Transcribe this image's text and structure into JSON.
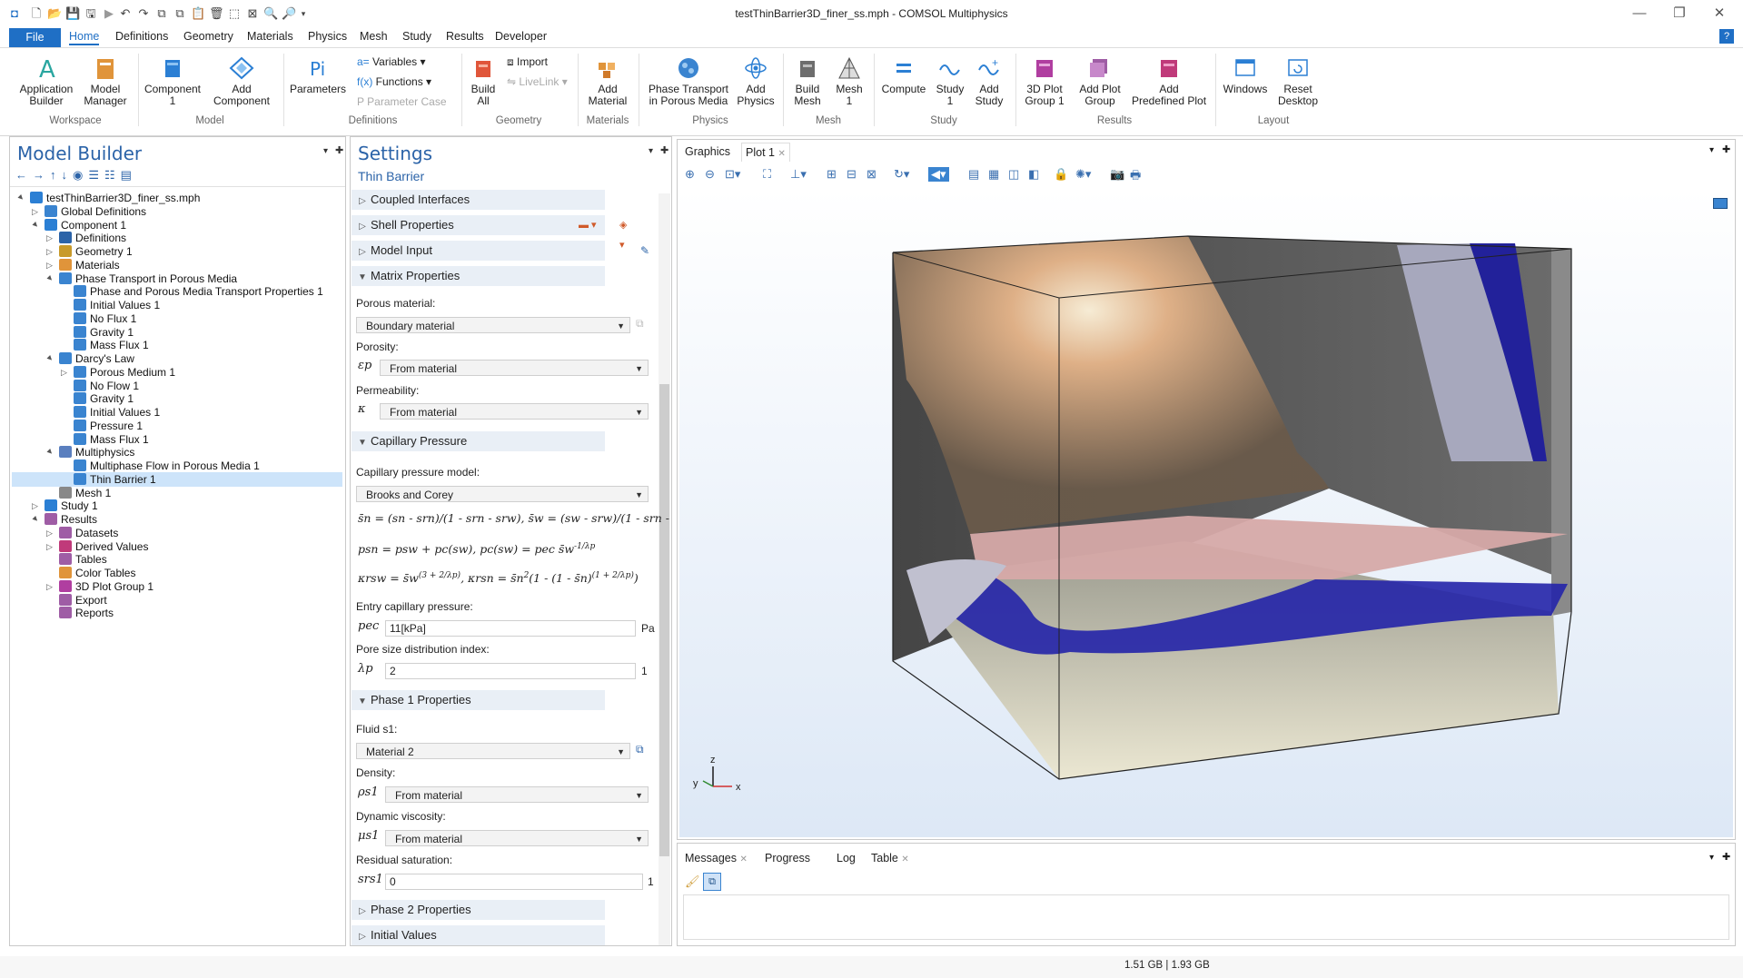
{
  "window": {
    "title": "testThinBarrier3D_finer_ss.mph - COMSOL Multiphysics"
  },
  "menu": [
    "File",
    "Home",
    "Definitions",
    "Geometry",
    "Materials",
    "Physics",
    "Mesh",
    "Study",
    "Results",
    "Developer"
  ],
  "ribbon": {
    "app_builder": "Application\nBuilder",
    "model_manager": "Model\nManager",
    "component": "Component\n1",
    "add_component": "Add\nComponent",
    "parameters": "Parameters",
    "variables": "Variables",
    "functions": "Functions",
    "parameter_case": "Parameter Case",
    "import": "Import",
    "livelink": "LiveLink",
    "build_all": "Build\nAll",
    "add_material": "Add\nMaterial",
    "phase_transport": "Phase Transport\nin Porous Media",
    "add_physics": "Add\nPhysics",
    "build_mesh": "Build\nMesh",
    "mesh1": "Mesh\n1",
    "compute": "Compute",
    "study1": "Study\n1",
    "add_study": "Add\nStudy",
    "plot3d": "3D Plot\nGroup 1",
    "add_plot_group": "Add Plot\nGroup",
    "add_predefined_plot": "Add\nPredefined Plot",
    "windows": "Windows",
    "reset_desktop": "Reset\nDesktop",
    "groups": [
      "Workspace",
      "Model",
      "Definitions",
      "Geometry",
      "Materials",
      "Physics",
      "Mesh",
      "Study",
      "Results",
      "Layout"
    ]
  },
  "model_builder": {
    "title": "Model Builder",
    "tree": [
      "testThinBarrier3D_finer_ss.mph",
      "Global Definitions",
      "Component 1",
      "Definitions",
      "Geometry 1",
      "Materials",
      "Phase Transport in Porous Media",
      "Phase and Porous Media Transport Properties 1",
      "Initial Values 1",
      "No Flux 1",
      "Gravity 1",
      "Mass Flux 1",
      "Darcy's Law",
      "Porous Medium 1",
      "No Flow 1",
      "Gravity 1",
      "Initial Values 1",
      "Pressure 1",
      "Mass Flux 1",
      "Multiphysics",
      "Multiphase Flow in Porous Media 1",
      "Thin Barrier 1",
      "Mesh 1",
      "Study 1",
      "Results",
      "Datasets",
      "Derived Values",
      "Tables",
      "Color Tables",
      "3D Plot Group 1",
      "Export",
      "Reports"
    ]
  },
  "settings": {
    "title": "Settings",
    "subtitle": "Thin Barrier",
    "sections": {
      "coupled": "Coupled Interfaces",
      "shell": "Shell Properties",
      "model_input": "Model Input",
      "matrix": "Matrix Properties",
      "capillary": "Capillary Pressure",
      "phase1": "Phase 1 Properties",
      "phase2": "Phase 2 Properties",
      "initial": "Initial Values"
    },
    "porous_material_label": "Porous material:",
    "porous_material_value": "Boundary material",
    "porosity_label": "Porosity:",
    "porosity_sym": "εp",
    "porosity_value": "From material",
    "permeability_label": "Permeability:",
    "permeability_sym": "κ",
    "permeability_value": "From material",
    "cap_model_label": "Capillary pressure model:",
    "cap_model_value": "Brooks and Corey",
    "eq1": "s̄n = (sn - srn)/(1 - srn - srw),   s̄w = (sw - srw)/(1 - srn - s",
    "eq2": "psn = psw + pc(sw),   pc(sw) = pec s̄w",
    "eq2_exp": "-1/λp",
    "eq3a": "κrsw = s̄w",
    "eq3a_exp": "(3 + 2/λp)",
    "eq3b": ",   κrsn = s̄n",
    "eq3b_exp": "2",
    "eq3c": "(1 - (1 - s̄n)",
    "eq3c_exp": "(1 + 2/λp)",
    "eq3d": ")",
    "entry_label": "Entry capillary pressure:",
    "entry_sym": "pec",
    "entry_value": "11[kPa]",
    "entry_unit": "Pa",
    "pore_label": "Pore size distribution index:",
    "pore_sym": "λp",
    "pore_value": "2",
    "pore_unit": "1",
    "fluid_label": "Fluid s1:",
    "fluid_value": "Material 2",
    "density_label": "Density:",
    "density_sym": "ρs1",
    "density_value": "From material",
    "visc_label": "Dynamic viscosity:",
    "visc_sym": "μs1",
    "visc_value": "From material",
    "resid_label": "Residual saturation:",
    "resid_sym": "srs1",
    "resid_value": "0",
    "resid_unit": "1"
  },
  "graphics": {
    "tabs": [
      "Graphics",
      "Plot 1"
    ],
    "axes": {
      "z": "z",
      "y": "y",
      "x": "x"
    }
  },
  "messages": {
    "tabs": [
      "Messages",
      "Progress",
      "Log",
      "Table"
    ]
  },
  "status": {
    "memory": "1.51 GB | 1.93 GB"
  }
}
